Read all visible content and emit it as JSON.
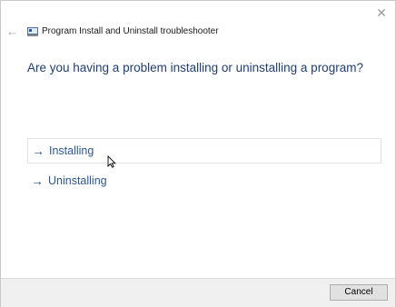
{
  "window": {
    "title": "Program Install and Uninstall troubleshooter",
    "close_glyph": "✕",
    "back_glyph": "←"
  },
  "main": {
    "question": "Are you having a problem installing or uninstalling a program?",
    "options": [
      {
        "label": "Installing",
        "arrow": "→"
      },
      {
        "label": "Uninstalling",
        "arrow": "→"
      }
    ]
  },
  "footer": {
    "cancel_label": "Cancel"
  },
  "colors": {
    "accent": "#2b5797",
    "heading": "#1f3e73"
  }
}
